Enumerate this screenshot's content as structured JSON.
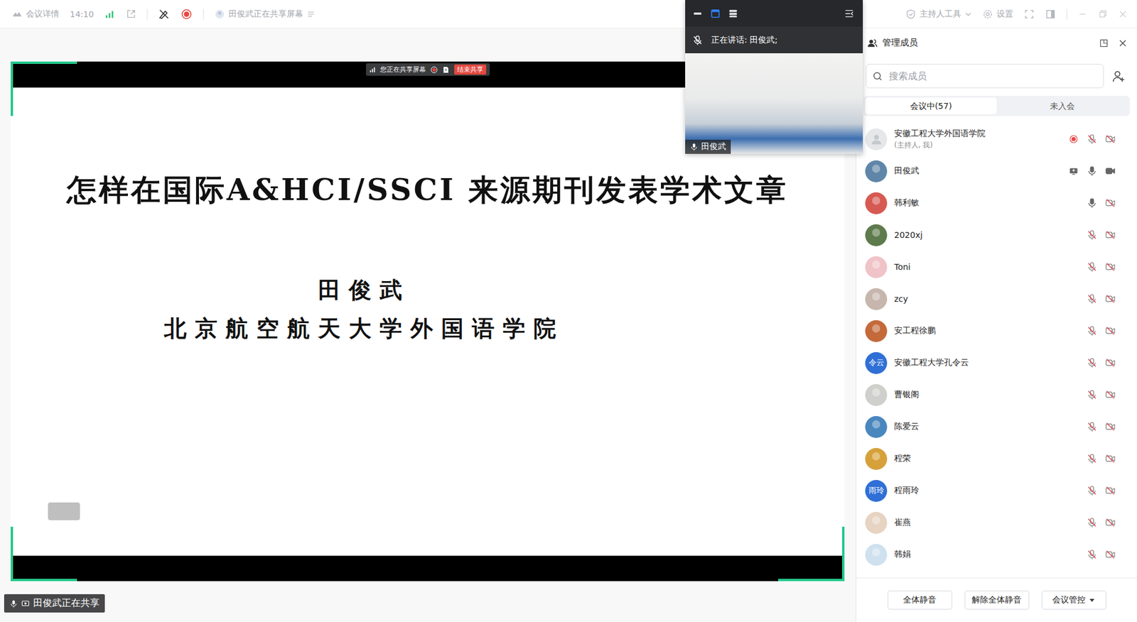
{
  "top_bar": {
    "meeting_info": "会议详情",
    "time": "14:10",
    "recording": true,
    "sharing_status": "田俊武正在共享屏幕",
    "host_tools": "主持人工具",
    "settings": "设置"
  },
  "shared_screen": {
    "share_toolbar": {
      "status": "您正在共享屏幕",
      "recording": true,
      "stop_button": "结束共享"
    },
    "slide": {
      "title": "怎样在国际A&HCI/SSCI 来源期刊发表学术文章",
      "author": "田俊武",
      "affiliation": "北京航空航天大学外国语学院"
    },
    "sharing_badge": "田俊武正在共享"
  },
  "video_window": {
    "speaking": "正在讲话: 田俊武;",
    "self_muted": true,
    "name": "田俊武",
    "mic_on": true
  },
  "members_panel": {
    "title": "管理成员",
    "search": {
      "placeholder": "搜索成员"
    },
    "tabs": [
      {
        "label": "会议中(57)",
        "selected": true
      },
      {
        "label": "未入会",
        "selected": false
      }
    ],
    "members": [
      {
        "name": "安徽工程大学外国语学院",
        "role": "(主持人, 我)",
        "avatar_kind": "default",
        "avatar_text": "",
        "color": "#e6e7e9",
        "recording": true,
        "sharing": false,
        "mic_on": false,
        "camera_on": false
      },
      {
        "name": "田俊武",
        "role": "",
        "avatar_kind": "photo",
        "avatar_text": "",
        "color": "#5f86a8",
        "recording": false,
        "sharing": true,
        "mic_on": true,
        "camera_on": true
      },
      {
        "name": "韩利敏",
        "role": "",
        "avatar_kind": "photo",
        "avatar_text": "",
        "color": "#d65a52",
        "recording": false,
        "sharing": false,
        "mic_on": true,
        "camera_on": false
      },
      {
        "name": "2020xj",
        "role": "",
        "avatar_kind": "photo",
        "avatar_text": "",
        "color": "#5d7b4c",
        "recording": false,
        "sharing": false,
        "mic_on": false,
        "camera_on": false
      },
      {
        "name": "Toni",
        "role": "",
        "avatar_kind": "photo",
        "avatar_text": "",
        "color": "#f0c3c8",
        "recording": false,
        "sharing": false,
        "mic_on": false,
        "camera_on": false
      },
      {
        "name": "zcy",
        "role": "",
        "avatar_kind": "photo",
        "avatar_text": "",
        "color": "#c7b6ad",
        "recording": false,
        "sharing": false,
        "mic_on": false,
        "camera_on": false
      },
      {
        "name": "安工程徐鹏",
        "role": "",
        "avatar_kind": "photo",
        "avatar_text": "",
        "color": "#c46a3a",
        "recording": false,
        "sharing": false,
        "mic_on": false,
        "camera_on": false
      },
      {
        "name": "安徽工程大学孔令云",
        "role": "",
        "avatar_kind": "text",
        "avatar_text": "令云",
        "color": "#2f6fd6",
        "recording": false,
        "sharing": false,
        "mic_on": false,
        "camera_on": false
      },
      {
        "name": "曹银阁",
        "role": "",
        "avatar_kind": "photo",
        "avatar_text": "",
        "color": "#cfd0cc",
        "recording": false,
        "sharing": false,
        "mic_on": false,
        "camera_on": false
      },
      {
        "name": "陈爱云",
        "role": "",
        "avatar_kind": "photo",
        "avatar_text": "",
        "color": "#4a87bf",
        "recording": false,
        "sharing": false,
        "mic_on": false,
        "camera_on": false
      },
      {
        "name": "程荣",
        "role": "",
        "avatar_kind": "photo",
        "avatar_text": "",
        "color": "#d6a13a",
        "recording": false,
        "sharing": false,
        "mic_on": false,
        "camera_on": false
      },
      {
        "name": "程雨玲",
        "role": "",
        "avatar_kind": "text",
        "avatar_text": "雨玲",
        "color": "#2f6fd6",
        "recording": false,
        "sharing": false,
        "mic_on": false,
        "camera_on": false
      },
      {
        "name": "崔燕",
        "role": "",
        "avatar_kind": "photo",
        "avatar_text": "",
        "color": "#e6d3c2",
        "recording": false,
        "sharing": false,
        "mic_on": false,
        "camera_on": false
      },
      {
        "name": "韩娟",
        "role": "",
        "avatar_kind": "photo",
        "avatar_text": "",
        "color": "#cfe1ef",
        "recording": false,
        "sharing": false,
        "mic_on": false,
        "camera_on": false
      }
    ],
    "buttons": [
      "全体静音",
      "解除全体静音",
      "会议管控"
    ]
  }
}
